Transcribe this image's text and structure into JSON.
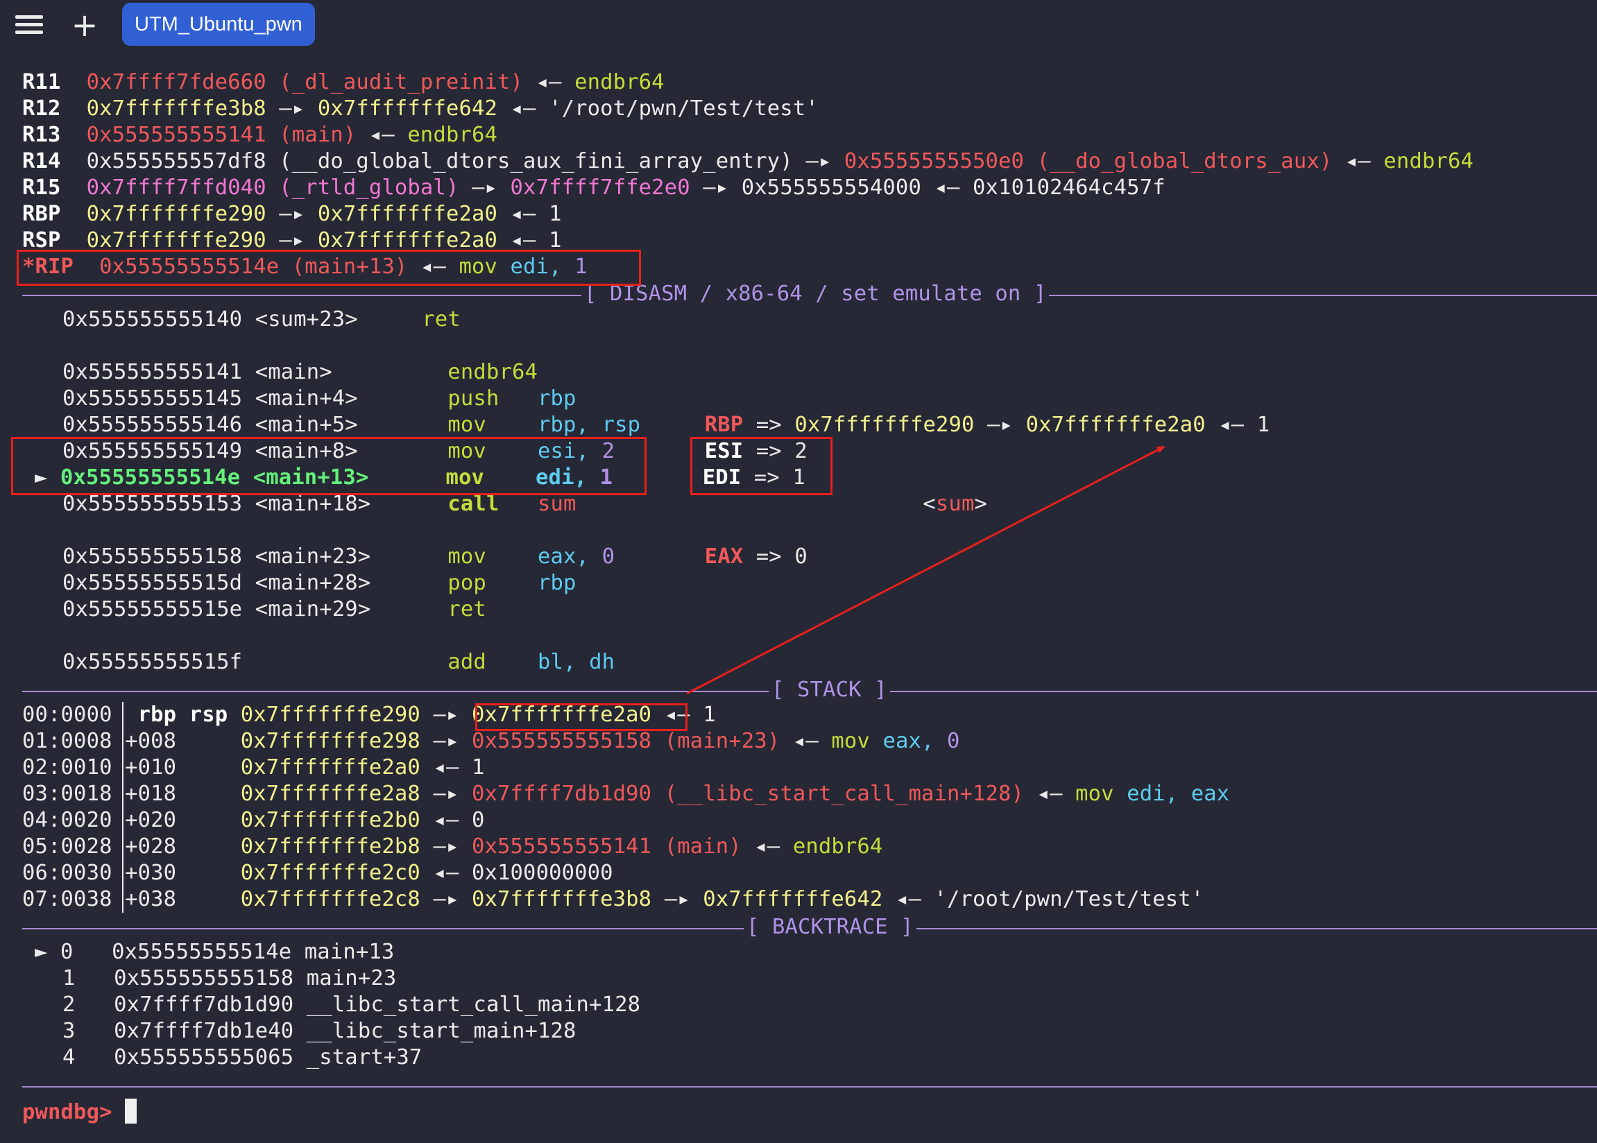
{
  "tab": {
    "title": "UTM_Ubuntu_pwn"
  },
  "icons": {
    "menu": "hamburger-menu-icon",
    "add": "plus-icon"
  },
  "registers": [
    {
      "name": "R11",
      "addr": "0x7ffff7fde660",
      "sym": "(_dl_audit_preinit)",
      "arrow": "◂—",
      "val": "endbr64"
    },
    {
      "name": "R12",
      "addr": "0x7fffffffe3b8",
      "arrow1": "—▸",
      "addr2": "0x7fffffffe642",
      "arrow2": "◂—",
      "val": "'/root/pwn/Test/test'"
    },
    {
      "name": "R13",
      "addr": "0x555555555141",
      "sym": "(main)",
      "arrow": "◂—",
      "val": "endbr64"
    },
    {
      "name": "R14",
      "addr": "0x555555557df8",
      "sym": "(__do_global_dtors_aux_fini_array_entry)",
      "arrow1": "—▸",
      "addr2": "0x5555555550e0",
      "sym2": "(__do_global_dtors_aux)",
      "arrow2": "◂—",
      "val": "endbr64"
    },
    {
      "name": "R15",
      "addr": "0x7ffff7ffd040",
      "sym": "(_rtld_global)",
      "arrow1": "—▸",
      "addr2": "0x7ffff7ffe2e0",
      "arrow2": "—▸",
      "addr3": "0x555555554000",
      "arrow3": "◂—",
      "val": "0x10102464c457f"
    },
    {
      "name": "RBP",
      "addr": "0x7fffffffe290",
      "arrow1": "—▸",
      "addr2": "0x7fffffffe2a0",
      "arrow2": "◂—",
      "val": "1"
    },
    {
      "name": "RSP",
      "addr": "0x7fffffffe290",
      "arrow1": "—▸",
      "addr2": "0x7fffffffe2a0",
      "arrow2": "◂—",
      "val": "1"
    },
    {
      "name": "*RIP",
      "addr": "0x55555555514e",
      "sym": "(main+13)",
      "arrow": "◂—",
      "mnem": "mov",
      "op1": "edi,",
      "op2": "1"
    }
  ],
  "headers": {
    "disasm": "[ DISASM / x86-64 / set emulate on ]",
    "stack": "[ STACK ]",
    "backtrace": "[ BACKTRACE ]"
  },
  "disasm": [
    {
      "addr": "0x555555555140",
      "label": "<sum+23>",
      "mnem": "ret"
    },
    {
      "addr": "0x555555555141",
      "label": "<main>",
      "mnem": "endbr64"
    },
    {
      "addr": "0x555555555145",
      "label": "<main+4>",
      "mnem": "push",
      "op1": "rbp"
    },
    {
      "addr": "0x555555555146",
      "label": "<main+5>",
      "mnem": "mov",
      "op1": "rbp,",
      "op2": "rsp",
      "note_reg": "RBP",
      "note_eq": "=>",
      "note_a": "0x7fffffffe290",
      "note_ar1": "—▸",
      "note_b": "0x7fffffffe2a0",
      "note_ar2": "◂—",
      "note_v": "1"
    },
    {
      "addr": "0x555555555149",
      "label": "<main+8>",
      "mnem": "mov",
      "op1": "esi,",
      "op2": "2",
      "note_reg": "ESI",
      "note_eq": "=>",
      "note_v": "2"
    },
    {
      "marker": "►",
      "addr": "0x55555555514e",
      "label": "<main+13>",
      "mnem": "mov",
      "op1": "edi,",
      "op2": "1",
      "note_reg": "EDI",
      "note_eq": "=>",
      "note_v": "1"
    },
    {
      "addr": "0x555555555153",
      "label": "<main+18>",
      "mnem": "call",
      "op1": "sum",
      "note_sym": "<sum>"
    },
    {
      "addr": "0x555555555158",
      "label": "<main+23>",
      "mnem": "mov",
      "op1": "eax,",
      "op2": "0",
      "note_reg": "EAX",
      "note_eq": "=>",
      "note_v": "0"
    },
    {
      "addr": "0x55555555515d",
      "label": "<main+28>",
      "mnem": "pop",
      "op1": "rbp"
    },
    {
      "addr": "0x55555555515e",
      "label": "<main+29>",
      "mnem": "ret"
    },
    {
      "addr": "0x55555555515f",
      "label": "",
      "mnem": "add",
      "op1": "bl,",
      "op2": "dh"
    }
  ],
  "stack": [
    {
      "idx": "00:0000",
      "off": "",
      "regs": "rbp rsp",
      "addr": "0x7fffffffe290",
      "a1": "—▸",
      "v1": "0x7fffffffe2a0",
      "a2": "◂—",
      "v2": "1"
    },
    {
      "idx": "01:0008",
      "off": "+008",
      "addr": "0x7fffffffe298",
      "a1": "—▸",
      "v1": "0x555555555158",
      "s1": "(main+23)",
      "a2": "◂—",
      "mnem": "mov",
      "op1": "eax,",
      "op2": "0"
    },
    {
      "idx": "02:0010",
      "off": "+010",
      "addr": "0x7fffffffe2a0",
      "a1": "◂—",
      "v1": "1"
    },
    {
      "idx": "03:0018",
      "off": "+018",
      "addr": "0x7fffffffe2a8",
      "a1": "—▸",
      "v1": "0x7ffff7db1d90",
      "s1": "(__libc_start_call_main+128)",
      "a2": "◂—",
      "mnem": "mov",
      "op1": "edi,",
      "op2": "eax"
    },
    {
      "idx": "04:0020",
      "off": "+020",
      "addr": "0x7fffffffe2b0",
      "a1": "◂—",
      "v1": "0"
    },
    {
      "idx": "05:0028",
      "off": "+028",
      "addr": "0x7fffffffe2b8",
      "a1": "—▸",
      "v1": "0x555555555141",
      "s1": "(main)",
      "a2": "◂—",
      "val": "endbr64"
    },
    {
      "idx": "06:0030",
      "off": "+030",
      "addr": "0x7fffffffe2c0",
      "a1": "◂—",
      "v1": "0x100000000"
    },
    {
      "idx": "07:0038",
      "off": "+038",
      "addr": "0x7fffffffe2c8",
      "a1": "—▸",
      "v1": "0x7fffffffe3b8",
      "a2": "—▸",
      "v2": "0x7fffffffe642",
      "a3": "◂—",
      "val": "'/root/pwn/Test/test'"
    }
  ],
  "backtrace": [
    {
      "marker": "►",
      "n": "0",
      "addr": "0x55555555514e",
      "sym": "main+13"
    },
    {
      "n": "1",
      "addr": "0x555555555158",
      "sym": "main+23"
    },
    {
      "n": "2",
      "addr": "0x7ffff7db1d90",
      "sym": "__libc_start_call_main+128"
    },
    {
      "n": "3",
      "addr": "0x7ffff7db1e40",
      "sym": "__libc_start_main+128"
    },
    {
      "n": "4",
      "addr": "0x555555555065",
      "sym": "_start+37"
    }
  ],
  "prompt": "pwndbg>",
  "annotation_color": "#e8201c"
}
